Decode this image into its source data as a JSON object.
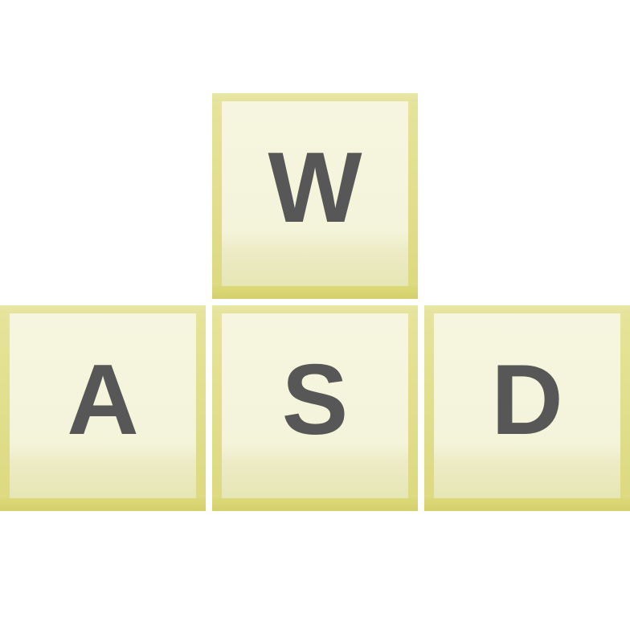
{
  "keys": [
    {
      "id": "w",
      "label": "W"
    },
    {
      "id": "a",
      "label": "A"
    },
    {
      "id": "s",
      "label": "S"
    },
    {
      "id": "d",
      "label": "D"
    }
  ],
  "colors": {
    "keycap_face": "#f6f6e0",
    "keycap_border": "#dcd980",
    "legend": "#575757",
    "background": "#ffffff"
  }
}
